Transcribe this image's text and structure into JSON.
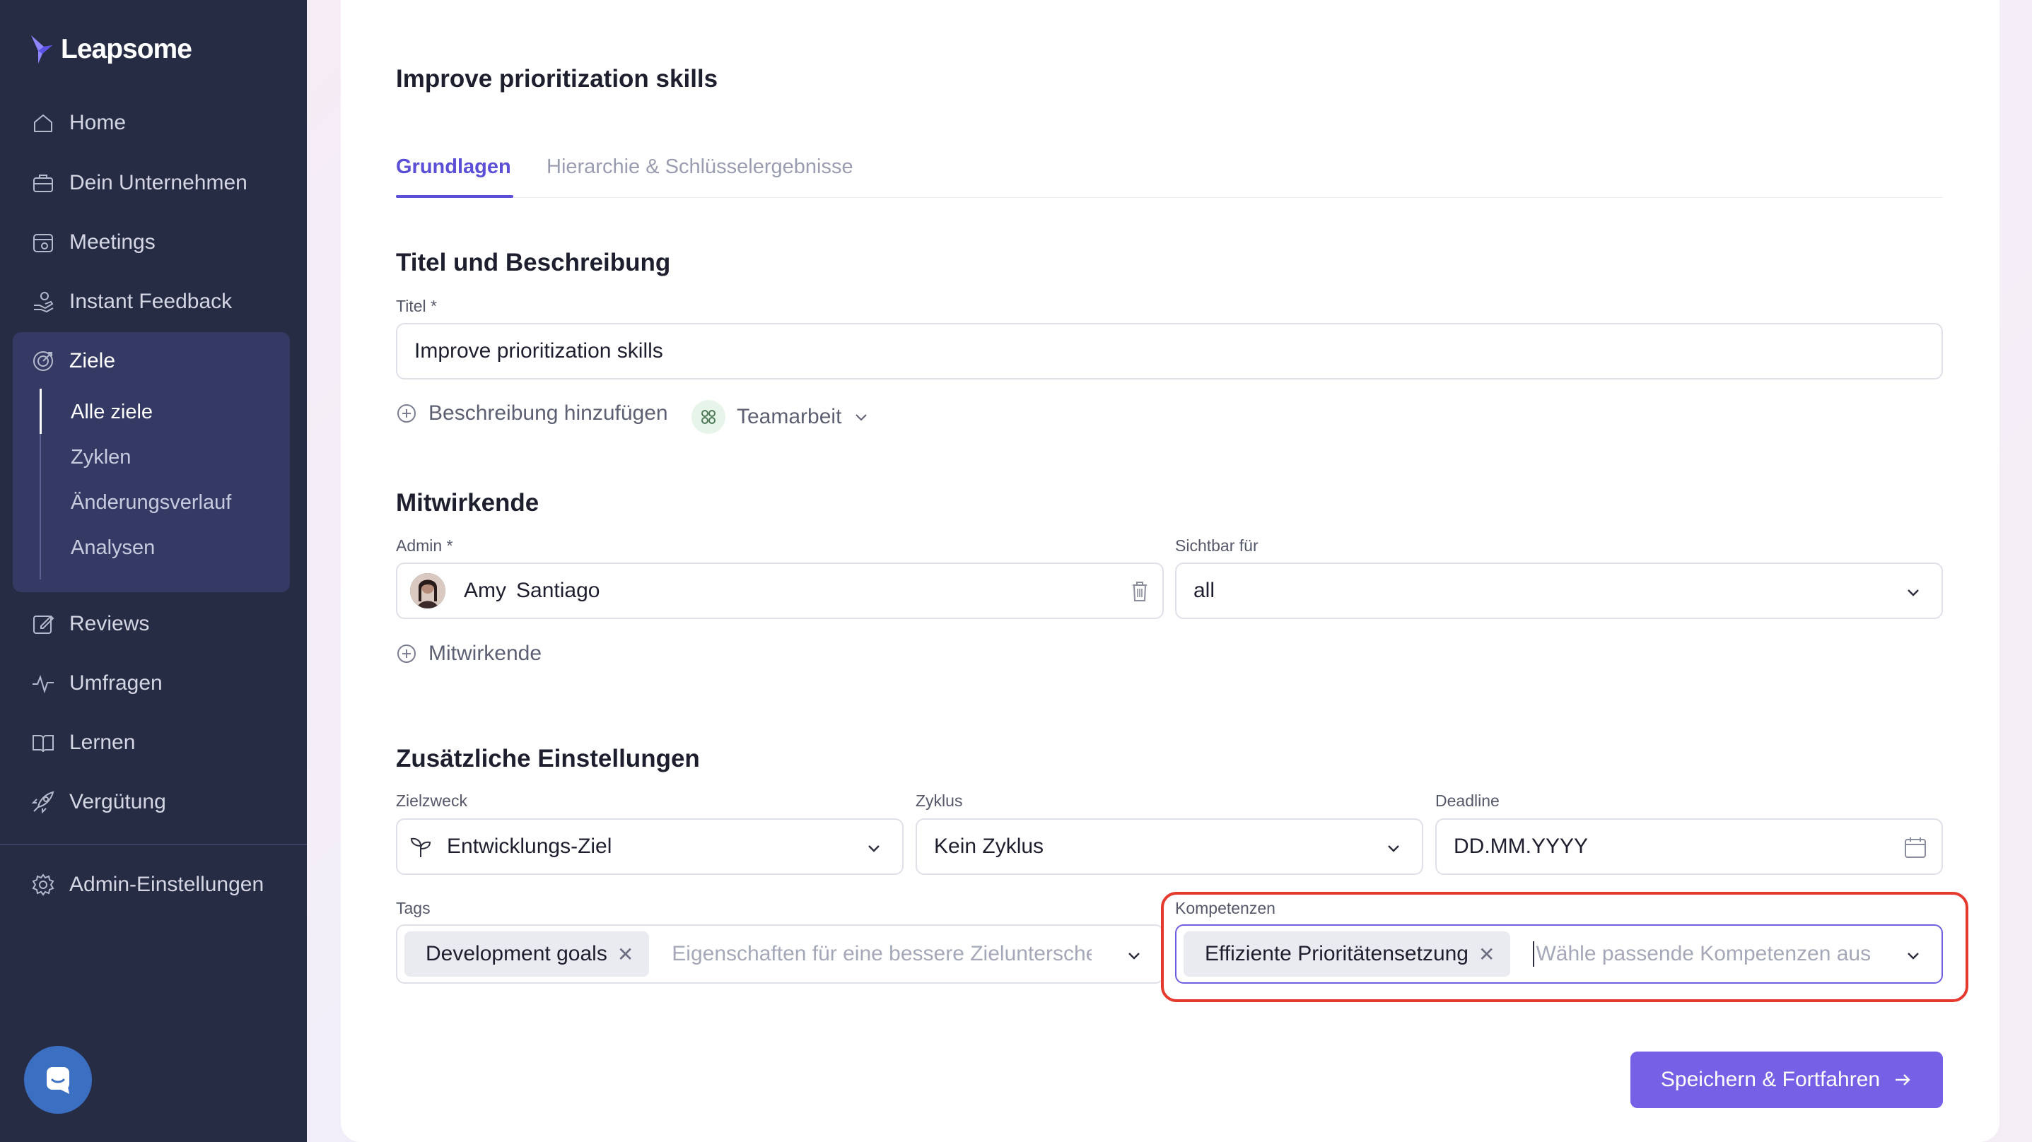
{
  "app": {
    "brand": "Leapsome"
  },
  "sidebar": {
    "items": [
      {
        "label": "Home",
        "icon": "home-icon"
      },
      {
        "label": "Dein Unternehmen",
        "icon": "briefcase-icon"
      },
      {
        "label": "Meetings",
        "icon": "meetings-icon"
      },
      {
        "label": "Instant Feedback",
        "icon": "feedback-hand-icon"
      },
      {
        "label": "Ziele",
        "icon": "target-icon"
      },
      {
        "label": "Reviews",
        "icon": "edit-icon"
      },
      {
        "label": "Umfragen",
        "icon": "pulse-icon"
      },
      {
        "label": "Lernen",
        "icon": "book-icon"
      },
      {
        "label": "Vergütung",
        "icon": "rocket-icon"
      },
      {
        "label": "Admin-Einstellungen",
        "icon": "gear-icon"
      }
    ],
    "ziele_sub": [
      "Alle ziele",
      "Zyklen",
      "Änderungsverlauf",
      "Analysen"
    ],
    "active_sub": "Alle ziele"
  },
  "page": {
    "title": "Improve prioritization skills",
    "tabs": [
      {
        "label": "Grundlagen",
        "active": true
      },
      {
        "label": "Hierarchie & Schlüsselergebnisse",
        "active": false
      }
    ]
  },
  "section_title_desc": {
    "heading": "Titel und Beschreibung",
    "title_label": "Titel *",
    "title_value": "Improve prioritization skills",
    "add_description": "Beschreibung hinzufügen",
    "category": "Teamarbeit"
  },
  "contributors": {
    "heading": "Mitwirkende",
    "admin_label": "Admin *",
    "admin_first": "Amy",
    "admin_last": "Santiago",
    "visible_label": "Sichtbar für",
    "visible_value": "all",
    "add_contributor": "Mitwirkende"
  },
  "extra": {
    "heading": "Zusätzliche Einstellungen",
    "purpose_label": "Zielzweck",
    "purpose_value": "Entwicklungs-Ziel",
    "cycle_label": "Zyklus",
    "cycle_value": "Kein Zyklus",
    "deadline_label": "Deadline",
    "deadline_placeholder": "DD.MM.YYYY",
    "tags_label": "Tags",
    "tag_chip": "Development goals",
    "tags_placeholder": "Eigenschaften für eine bessere Zielunterscheidung",
    "competencies_label": "Kompetenzen",
    "competency_chip": "Effiziente Prioritätensetzung",
    "competencies_placeholder": "Wähle passende Kompetenzen aus"
  },
  "actions": {
    "save_label": "Speichern & Fortfahren"
  },
  "colors": {
    "sidebar_bg": "#272c45",
    "accent": "#5b4fd6",
    "button": "#7560e6",
    "highlight": "#e5392d"
  }
}
